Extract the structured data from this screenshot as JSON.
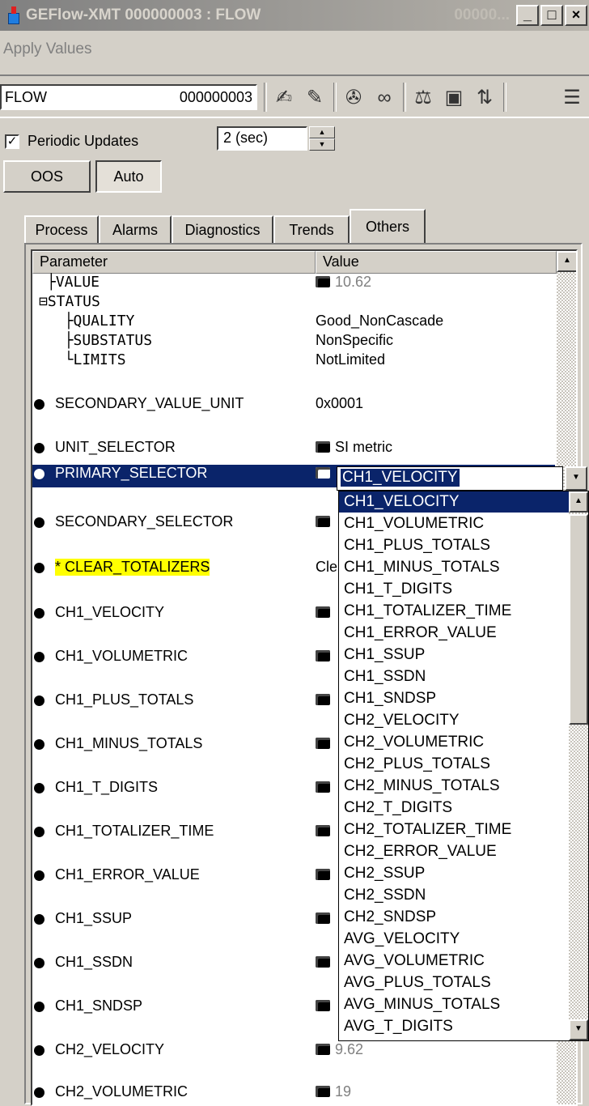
{
  "window": {
    "title": "GEFlow-XMT  000000003 : FLOW",
    "title_extra": "00000...",
    "minimize": "_",
    "maximize": "□",
    "close": "×"
  },
  "menu": {
    "items": [
      "Apply Values"
    ]
  },
  "toolbar": {
    "tag": "FLOW",
    "id": "000000003"
  },
  "periodic": {
    "checked": "✓",
    "label": "Periodic Updates",
    "interval": "2 (sec)"
  },
  "modes": {
    "oos": "OOS",
    "auto": "Auto"
  },
  "tabs": [
    "Process",
    "Alarms",
    "Diagnostics",
    "Trends",
    "Others"
  ],
  "grid": {
    "col_param": "Parameter",
    "col_value": "Value",
    "tree_rows": [
      {
        "name": "├VALUE",
        "value": "10.62"
      },
      {
        "name": "⊟STATUS",
        "value": ""
      },
      {
        "name": "  ├QUALITY",
        "value": "Good_NonCascade"
      },
      {
        "name": "  ├SUBSTATUS",
        "value": "NonSpecific"
      },
      {
        "name": "  └LIMITS",
        "value": "NotLimited"
      }
    ],
    "rows": [
      {
        "name": "SECONDARY_VALUE_UNIT",
        "value": "0x0001"
      },
      {
        "name": "UNIT_SELECTOR",
        "value": "SI metric"
      },
      {
        "name": "PRIMARY_SELECTOR",
        "value": ""
      },
      {
        "name": "SECONDARY_SELECTOR",
        "value": ""
      },
      {
        "name": "* CLEAR_TOTALIZERS",
        "value": "Cle"
      },
      {
        "name": "CH1_VELOCITY",
        "value": ""
      },
      {
        "name": "CH1_VOLUMETRIC",
        "value": ""
      },
      {
        "name": "CH1_PLUS_TOTALS",
        "value": ""
      },
      {
        "name": "CH1_MINUS_TOTALS",
        "value": ""
      },
      {
        "name": "CH1_T_DIGITS",
        "value": ""
      },
      {
        "name": "CH1_TOTALIZER_TIME",
        "value": ""
      },
      {
        "name": "CH1_ERROR_VALUE",
        "value": ""
      },
      {
        "name": "CH1_SSUP",
        "value": ""
      },
      {
        "name": "CH1_SSDN",
        "value": ""
      },
      {
        "name": "CH1_SNDSP",
        "value": ""
      },
      {
        "name": "CH2_VELOCITY",
        "value": "9.62"
      },
      {
        "name": "CH2_VOLUMETRIC",
        "value": "19"
      }
    ]
  },
  "dropdown": {
    "selected": "CH1_VELOCITY",
    "options": [
      "CH1_VELOCITY",
      "CH1_VOLUMETRIC",
      "CH1_PLUS_TOTALS",
      "CH1_MINUS_TOTALS",
      "CH1_T_DIGITS",
      "CH1_TOTALIZER_TIME",
      "CH1_ERROR_VALUE",
      "CH1_SSUP",
      "CH1_SSDN",
      "CH1_SNDSP",
      "CH2_VELOCITY",
      "CH2_VOLUMETRIC",
      "CH2_PLUS_TOTALS",
      "CH2_MINUS_TOTALS",
      "CH2_T_DIGITS",
      "CH2_TOTALIZER_TIME",
      "CH2_ERROR_VALUE",
      "CH2_SSUP",
      "CH2_SSDN",
      "CH2_SNDSP",
      "AVG_VELOCITY",
      "AVG_VOLUMETRIC",
      "AVG_PLUS_TOTALS",
      "AVG_MINUS_TOTALS",
      "AVG_T_DIGITS"
    ]
  },
  "colors": {
    "selection": "#0a246a",
    "highlight": "#ffff00",
    "face": "#d4d0c8"
  }
}
